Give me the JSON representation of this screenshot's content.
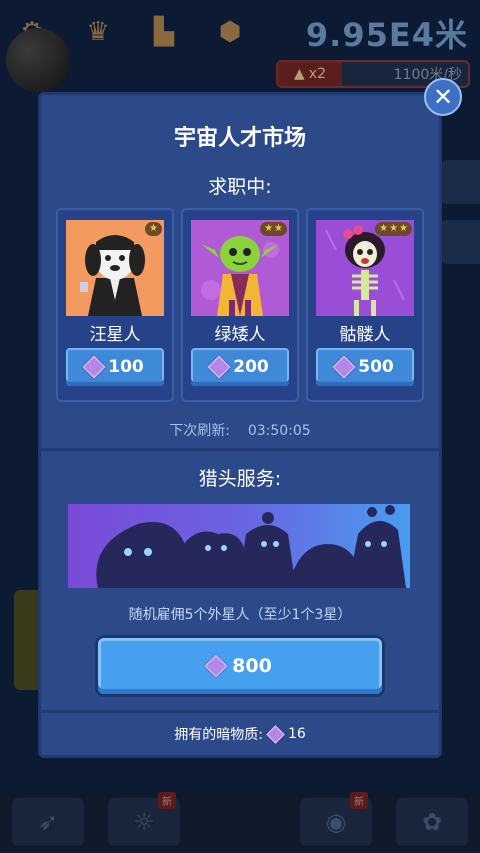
{
  "hud": {
    "distance": "9.95E4米",
    "multiplier": "x2",
    "speed": "1100米/秒"
  },
  "modal": {
    "title": "宇宙人才市场",
    "job_seeking_label": "求职中:",
    "close_symbol": "✕",
    "cards": [
      {
        "name": "汪星人",
        "price": "100",
        "stars": 1
      },
      {
        "name": "绿矮人",
        "price": "200",
        "stars": 2
      },
      {
        "name": "骷髅人",
        "price": "500",
        "stars": 3
      }
    ],
    "refresh_label": "下次刷新:",
    "refresh_time": "03:50:05",
    "headhunt_label": "猎头服务:",
    "headhunt_desc": "随机雇佣5个外星人（至少1个3星）",
    "headhunt_price": "800",
    "dark_matter_label": "拥有的暗物质:",
    "dark_matter_count": "16"
  },
  "bottom_bar": {
    "new_badge": "新"
  },
  "colors": {
    "modal_bg": "#2c4a8a",
    "button_blue": "#46a0ef",
    "gem_purple": "#b486e6",
    "star_gold": "#f2c44a"
  },
  "icons": [
    "gear-icon",
    "trophy-icon",
    "podium-icon",
    "chat-icon",
    "gem-icon",
    "star-icon",
    "close-icon",
    "rocket-icon",
    "telescope-icon"
  ]
}
